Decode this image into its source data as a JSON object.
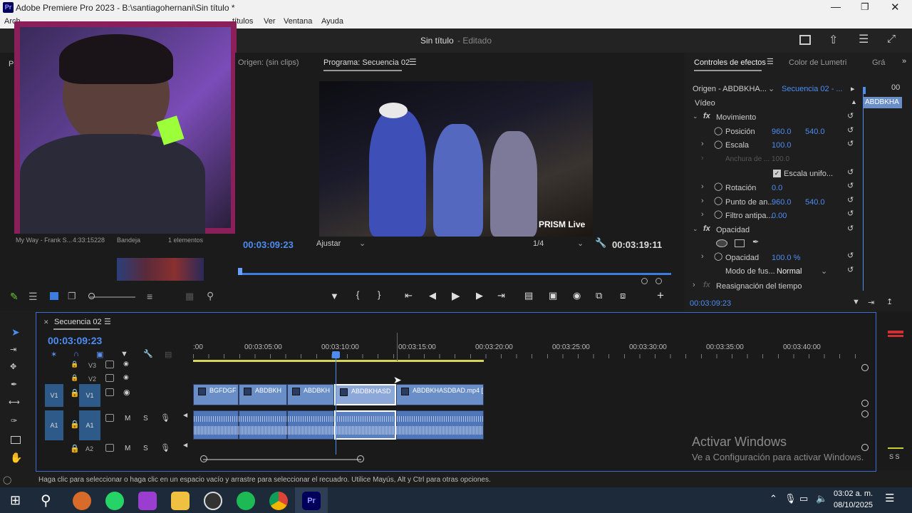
{
  "window": {
    "title": "Adobe Premiere Pro 2023 - B:\\santiagohernani\\Sin título *",
    "app_icon": "Pr"
  },
  "menu": [
    "Arch",
    "Ver",
    "Ventana",
    "Ayuda"
  ],
  "menu_partial": "títulos",
  "header": {
    "project_title": "Sin título",
    "status": "- Editado"
  },
  "webcam": {
    "label": "webcam-overlay"
  },
  "source": {
    "tab_partial": "Pro",
    "label": "Origen: (sin clips)"
  },
  "program": {
    "title": "Programa: Secuencia 02",
    "timecode": "00:03:09:23",
    "fit": "Ajustar",
    "quality": "1/4",
    "duration": "00:03:19:11",
    "watermark": "PRISM Live"
  },
  "project_panel": {
    "item": "My Way - Frank S...",
    "duration": "4:33:15228",
    "bin": "Bandeja",
    "count": "1 elementos"
  },
  "effects": {
    "tabs": [
      "Controles de efectos",
      "Color de Lumetri",
      "Grá"
    ],
    "origin": "Origen - ABDBKHA...",
    "sequence": "Secuencia 02 - ...",
    "clip_label": "ABDBKHA",
    "time_top": "00",
    "video_label": "Vídeo",
    "motion": "Movimiento",
    "position": {
      "label": "Posición",
      "x": "960.0",
      "y": "540.0"
    },
    "scale": {
      "label": "Escala",
      "value": "100.0"
    },
    "width": {
      "label": "Anchura de ...",
      "value": "100.0"
    },
    "uniform": "Escala unifo...",
    "rotation": {
      "label": "Rotación",
      "value": "0.0"
    },
    "anchor": {
      "label": "Punto de an...",
      "x": "960.0",
      "y": "540.0"
    },
    "antiflicker": {
      "label": "Filtro antipa...",
      "value": "0.00"
    },
    "opacity_group": "Opacidad",
    "opacity": {
      "label": "Opacidad",
      "value": "100.0 %"
    },
    "blend": {
      "label": "Modo de fus...",
      "value": "Normal"
    },
    "remap": "Reasignación del tiempo",
    "timecode": "00:03:09:23"
  },
  "timeline": {
    "title": "Secuencia 02",
    "timecode": "00:03:09:23",
    "ruler": [
      ":00",
      "00:03:05:00",
      "00:03:10:00",
      "00:03:15:00",
      "00:03:20:00",
      "00:03:25:00",
      "00:03:30:00",
      "00:03:35:00",
      "00:03:40:00"
    ],
    "tracks": {
      "v3": "V3",
      "v2": "V2",
      "v1": "V1",
      "a1": "A1",
      "a2": "A2",
      "m": "M",
      "s": "S"
    },
    "clips": [
      "BGFDGF",
      "ABDBKH",
      "ABDBKH",
      "ABDBKHASD",
      "ABDBKHASDBAD.mp4 ["
    ]
  },
  "activation": {
    "title": "Activar Windows",
    "subtitle": "Ve a Configuración para activar Windows."
  },
  "statusbar": "Haga clic para seleccionar o haga clic en un espacio vacío y arrastre para seleccionar el recuadro. Utilice Mayús, Alt y Ctrl para otras opciones.",
  "meter": "S S",
  "taskbar": {
    "time": "03:02 a. m.",
    "date": "08/10/2025"
  }
}
